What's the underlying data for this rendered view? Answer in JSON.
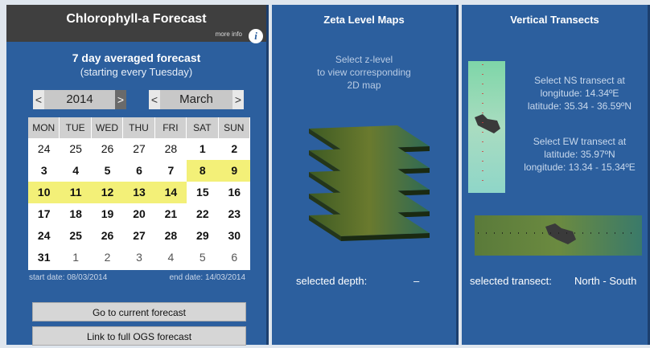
{
  "forecast": {
    "title": "Chlorophyll-a Forecast",
    "more_info": "more info",
    "info_glyph": "i",
    "subtitle": "7 day averaged forecast",
    "subtitle2": "(starting every Tuesday)",
    "year": {
      "prev": "<",
      "value": "2014",
      "next": ">"
    },
    "month": {
      "prev": "<",
      "value": "March",
      "next": ">"
    },
    "calendar": {
      "weekdays": [
        "MON",
        "TUE",
        "WED",
        "THU",
        "FRI",
        "SAT",
        "SUN"
      ],
      "highlighted_color": "#f3f078",
      "weeks": [
        [
          "24",
          "25",
          "26",
          "27",
          "28",
          "1",
          "2"
        ],
        [
          "3",
          "4",
          "5",
          "6",
          "7",
          "8",
          "9"
        ],
        [
          "10",
          "11",
          "12",
          "13",
          "14",
          "15",
          "16"
        ],
        [
          "17",
          "18",
          "19",
          "20",
          "21",
          "22",
          "23"
        ],
        [
          "24",
          "25",
          "26",
          "27",
          "28",
          "29",
          "30"
        ],
        [
          "31",
          "1",
          "2",
          "3",
          "4",
          "5",
          "6"
        ]
      ]
    },
    "start_date": "start date: 08/03/2014",
    "end_date": "end date: 14/03/2014",
    "buttons": {
      "current": "Go to current forecast",
      "full": "Link to full OGS forecast"
    }
  },
  "zeta": {
    "title": "Zeta Level Maps",
    "description_lines": [
      "Select z-level",
      "to view corresponding",
      "2D map"
    ],
    "selected_label": "selected depth:",
    "selected_value": "–"
  },
  "vertical": {
    "title": "Vertical Transects",
    "ns_lines": [
      "Select NS transect at",
      "longitude: 14.34ºE",
      "latitude: 35.34 - 36.59ºN"
    ],
    "ew_lines": [
      "Select EW transect at",
      "latitude: 35.97ºN",
      "longitude: 13.34 - 15.34ºE"
    ],
    "selected_label": "selected transect:",
    "selected_value": "North - South"
  },
  "colors": {
    "panel": "#2c5f9e",
    "title_bar": "#3f3f3f",
    "highlight": "#f3f078"
  },
  "icons": [
    "info-icon",
    "map-layer-stack-icon",
    "ns-transect-map-icon",
    "ew-transect-map-icon"
  ]
}
